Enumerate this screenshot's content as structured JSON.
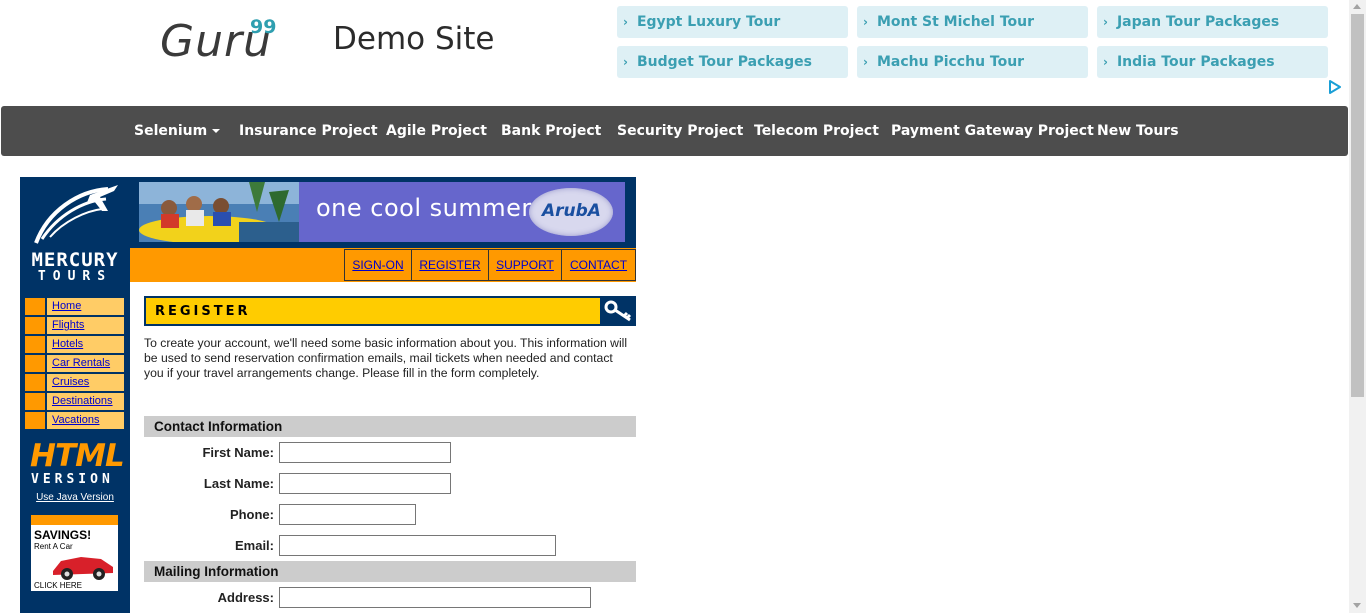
{
  "header": {
    "logo_text": "Guru",
    "logo_sup": "99",
    "site_title": "Demo Site",
    "tours": [
      "Egypt Luxury Tour",
      "Mont St Michel Tour",
      "Japan Tour Packages",
      "Budget Tour Packages",
      "Machu Picchu Tour",
      "India Tour Packages"
    ],
    "tour_chevron": "›"
  },
  "nav": {
    "items": [
      "Selenium",
      "Insurance Project",
      "Agile Project",
      "Bank Project",
      "Security Project",
      "Telecom Project",
      "Payment Gateway Project",
      "New Tours"
    ]
  },
  "banner": {
    "text": "one cool summer",
    "brand": "ArubA"
  },
  "top_links": [
    "SIGN-ON",
    "REGISTER",
    "SUPPORT",
    "CONTACT"
  ],
  "sidebar": {
    "logo_line1": "MERCURY",
    "logo_line2": "TOURS",
    "items": [
      "Home",
      "Flights",
      "Hotels",
      "Car Rentals",
      "Cruises",
      "Destinations",
      "Vacations"
    ],
    "html_text": "HTML",
    "version_text": "VERSION",
    "java_link": "Use Java Version",
    "savings_title": "SAVINGS!",
    "savings_sub": "Rent A Car",
    "savings_click": "CLICK HERE"
  },
  "register": {
    "title": "REGISTER",
    "intro": "To create your account, we'll need some basic information about you. This information will be used to send reservation confirmation emails, mail tickets when needed and contact you if your travel arrangements change. Please fill in the form completely.",
    "contact_header": "Contact Information",
    "mailing_header": "Mailing Information",
    "fields": {
      "first_name": {
        "label": "First Name:",
        "value": ""
      },
      "last_name": {
        "label": "Last Name:",
        "value": ""
      },
      "phone": {
        "label": "Phone:",
        "value": ""
      },
      "email": {
        "label": "Email:",
        "value": ""
      },
      "address": {
        "label": "Address:",
        "value": ""
      }
    }
  },
  "colors": {
    "navy": "#003366",
    "orange": "#ff9900",
    "yellow": "#ffcc00",
    "nav_bg": "#4d4d4d",
    "tile_bg": "#def0f5",
    "tile_text": "#3b9fb2"
  }
}
